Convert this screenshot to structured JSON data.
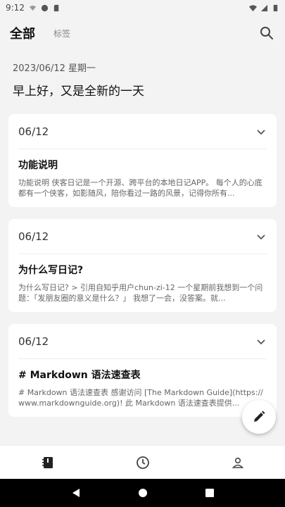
{
  "status_bar": {
    "time": "9:12"
  },
  "header": {
    "tab_all": "全部",
    "tab_tags": "标签"
  },
  "summary": {
    "date": "2023/06/12 星期一",
    "greeting": "早上好，又是全新的一天"
  },
  "entries": [
    {
      "date": "06/12",
      "title": "功能说明",
      "preview": "功能说明  侠客日记是一个开源、跨平台的本地日记APP。  每个人的心底都有一个侠客，如影随风，陪你看过一路的风景，记得你所有..."
    },
    {
      "date": "06/12",
      "title": "为什么写日记?",
      "preview": "为什么写日记?   > 引用自知乎用户chun-zi-12  一个星期前我想到一个问题：「发朋友圈的意义是什么？」  我想了一会，没答案。就..."
    },
    {
      "date": "06/12",
      "title": "# Markdown 语法速查表",
      "preview": "# Markdown 语法速查表 感谢访问 [The Markdown Guide](https://www.markdownguide.org)! 此 Markdown 语法速查表提供..."
    }
  ],
  "bottom_nav": [
    "diary-icon",
    "history-icon",
    "profile-icon"
  ],
  "colors": {
    "background": "#f3f3f4",
    "card": "#ffffff",
    "title": "#111111",
    "muted": "#666666"
  }
}
